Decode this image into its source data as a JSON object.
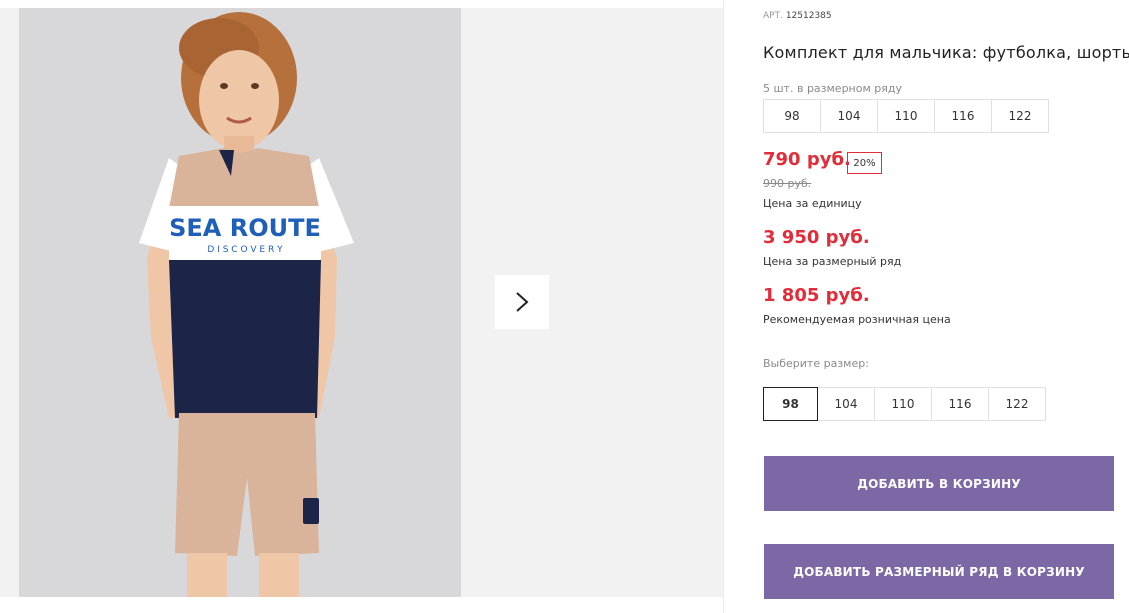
{
  "gallery": {
    "next_icon": "chevron-right-icon",
    "photo": {
      "shirt_print_line1": "SEA ROUTE",
      "shirt_print_line2": "D  I  S  C  O  V  E  R  Y"
    }
  },
  "product": {
    "art_label": "АРТ.",
    "art_number": "12512385",
    "title": "Комплект для мальчика: футболка, шорты",
    "series_note": "5 шт. в размерном ряду",
    "series_sizes": [
      "98",
      "104",
      "110",
      "116",
      "122"
    ],
    "price_unit": "790 руб.",
    "discount": "20%",
    "old_price": "990 руб.",
    "price_unit_caption": "Цена за единицу",
    "price_series": "3 950 руб.",
    "price_series_caption": "Цена за размерный ряд",
    "price_retail": "1 805 руб.",
    "price_retail_caption": "Рекомендуемая розничная цена",
    "choose_size_label": "Выберите размер:",
    "sizes": [
      "98",
      "104",
      "110",
      "116",
      "122"
    ],
    "selected_size": "98",
    "add_to_cart": "ДОБАВИТЬ В КОРЗИНУ",
    "add_series_to_cart": "ДОБАВИТЬ РАЗМЕРНЫЙ РЯД В КОРЗИНУ"
  },
  "colors": {
    "price_red": "#e12d39",
    "button_purple": "#7b68a5",
    "shirt_navy": "#1c2448",
    "shirt_beige": "#d9b49a",
    "print_blue": "#1f5fb8"
  }
}
